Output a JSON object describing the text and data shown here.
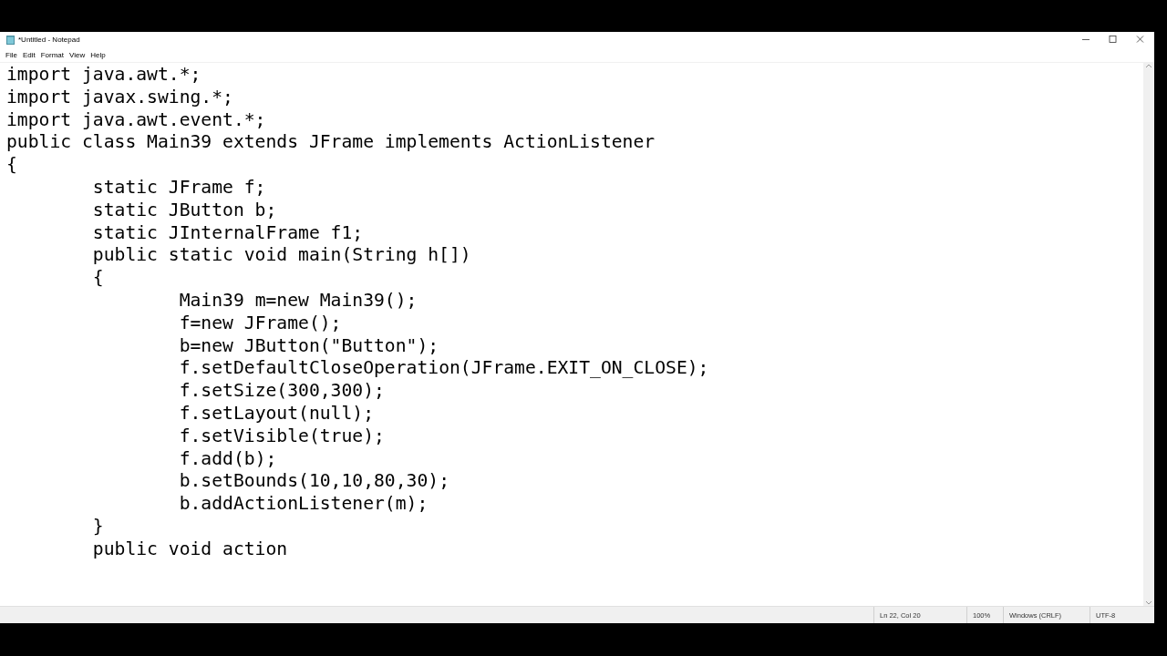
{
  "window": {
    "title": "*Untitled - Notepad"
  },
  "menu": [
    "File",
    "Edit",
    "Format",
    "View",
    "Help"
  ],
  "editor": {
    "lines": [
      "import java.awt.*;",
      "import javax.swing.*;",
      "import java.awt.event.*;",
      "public class Main39 extends JFrame implements ActionListener",
      "{",
      "\tstatic JFrame f;",
      "\tstatic JButton b;",
      "\tstatic JInternalFrame f1;",
      "\tpublic static void main(String h[])",
      "\t{",
      "\t\tMain39 m=new Main39();",
      "\t\tf=new JFrame();",
      "\t\tb=new JButton(\"Button\");",
      "\t\tf.setDefaultCloseOperation(JFrame.EXIT_ON_CLOSE);",
      "\t\tf.setSize(300,300);",
      "\t\tf.setLayout(null);",
      "\t\tf.setVisible(true);",
      "\t\tf.add(b);",
      "\t\tb.setBounds(10,10,80,30);",
      "\t\tb.addActionListener(m);",
      "\t}",
      "\tpublic void action"
    ]
  },
  "status_bar": {
    "position": "Ln 22, Col 20",
    "zoom": "100%",
    "line_ending": "Windows (CRLF)",
    "encoding": "UTF-8"
  }
}
